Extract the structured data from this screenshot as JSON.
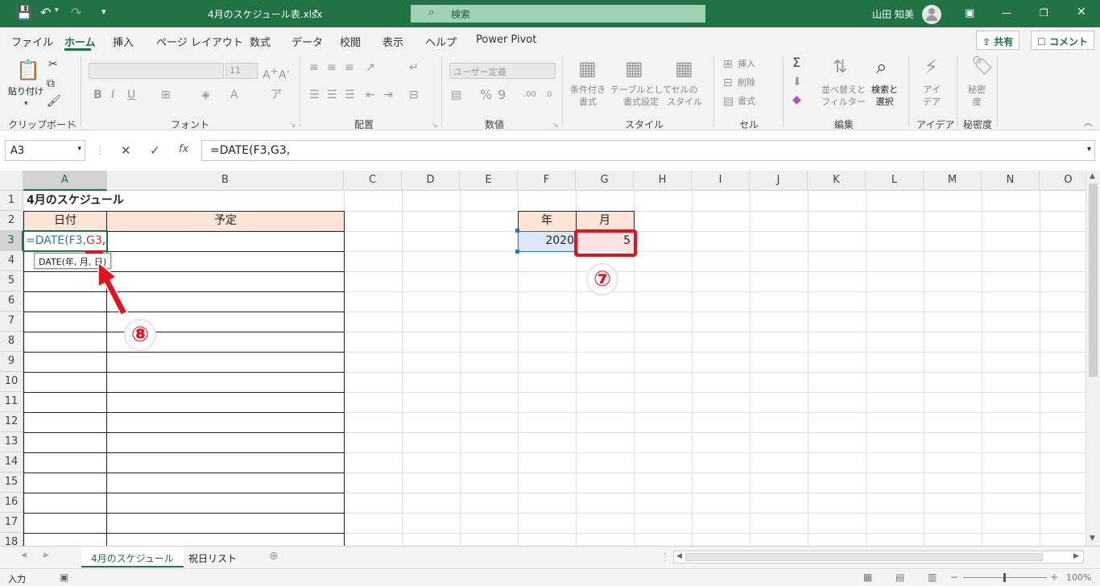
{
  "titlebar": {
    "filename": "4月のスケジュール表.xlsx",
    "search_label": "検索",
    "user_name": "山田 知美"
  },
  "menu": {
    "tabs": [
      "ファイル",
      "ホーム",
      "挿入",
      "ページ レイアウト",
      "数式",
      "データ",
      "校閲",
      "表示",
      "ヘルプ",
      "Power Pivot"
    ],
    "active_tab": "ホーム",
    "share_label": "共有",
    "comment_label": "コメント"
  },
  "ribbon": {
    "groups": [
      "クリップボード",
      "フォント",
      "配置",
      "数値",
      "スタイル",
      "セル",
      "編集",
      "アイデア",
      "秘密度"
    ],
    "paste_label": "貼り付け",
    "font_size": "11",
    "number_format": "ユーザー定義",
    "conditional_format": "条件付き\n書式",
    "table_format": "テーブルとして\n書式設定",
    "cell_style": "セルの\nスタイル",
    "insert": "挿入",
    "delete": "削除",
    "format": "書式",
    "sort_filter": "並べ替えと\nフィルター",
    "find_select": "検索と\n選択",
    "ideas": "アイ\nデア",
    "sensitivity": "秘密\n度"
  },
  "formula_bar": {
    "name_box": "A3",
    "formula": "=DATE(F3,G3,"
  },
  "grid": {
    "columns": [
      "A",
      "B",
      "C",
      "D",
      "E",
      "F",
      "G",
      "H",
      "I",
      "J",
      "K",
      "L",
      "M",
      "N",
      "O"
    ],
    "rows": [
      "1",
      "2",
      "3",
      "4",
      "5",
      "6",
      "7",
      "8",
      "9",
      "10",
      "11",
      "12",
      "13",
      "14",
      "15",
      "16",
      "17",
      "18"
    ],
    "title": "4月のスケジュール",
    "header_date": "日付",
    "header_plan": "予定",
    "editing_prefix": "=DATE(F3,",
    "editing_ref": "G3",
    "editing_suffix": ",",
    "tooltip": "DATE(年, 月, 日)",
    "year_header": "年",
    "month_header": "月",
    "year_value": "2020",
    "month_value": "5"
  },
  "annotations": {
    "marker_7": "⑦",
    "marker_8": "⑧"
  },
  "sheets": {
    "tabs": [
      "4月のスケジュール",
      "祝日リスト"
    ],
    "active": "4月のスケジュール"
  },
  "status": {
    "mode": "入力",
    "zoom": "100%"
  },
  "colors": {
    "excel_green": "#217346",
    "header_fill": "#fce4d6",
    "highlight_red": "#e8101b",
    "ref_blue": "#2e74b5",
    "ref_red": "#c0392b"
  }
}
